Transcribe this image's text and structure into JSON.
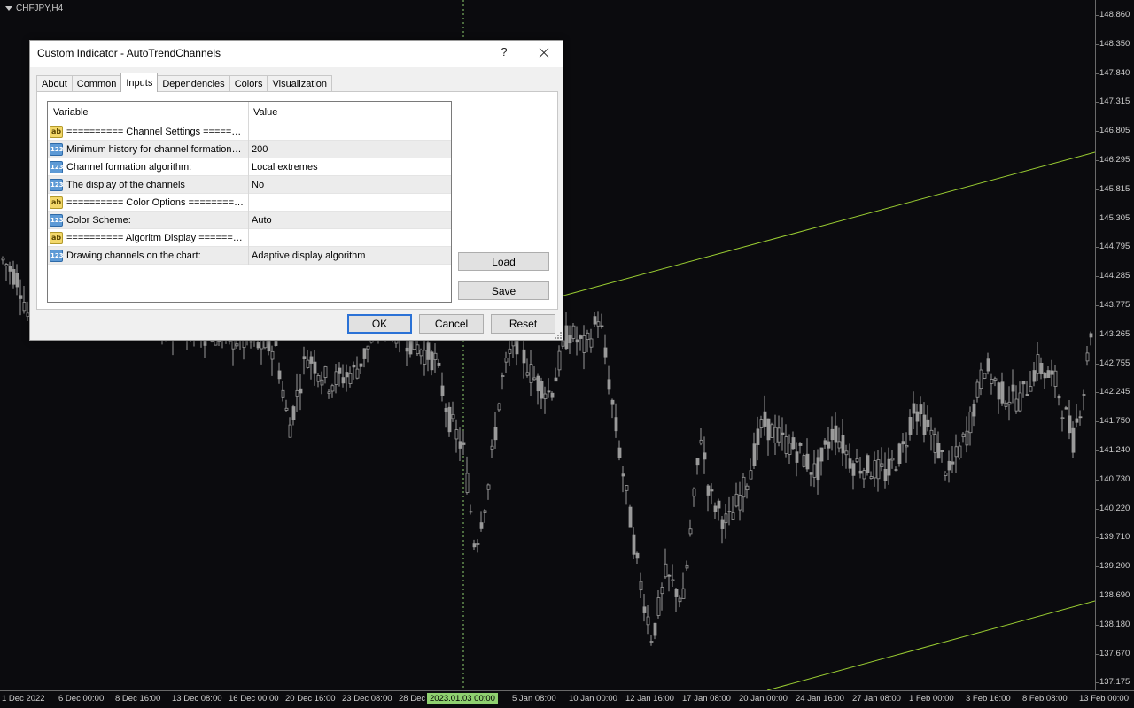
{
  "chart": {
    "symbol": "CHFJPY,H4",
    "price_ticks": [
      "148.860",
      "148.350",
      "147.840",
      "147.315",
      "146.805",
      "146.295",
      "145.815",
      "145.305",
      "144.795",
      "144.285",
      "143.775",
      "143.265",
      "142.755",
      "142.245",
      "141.750",
      "141.240",
      "140.730",
      "140.220",
      "139.710",
      "139.200",
      "138.690",
      "138.180",
      "137.670",
      "137.175"
    ],
    "time_ticks": [
      "1 Dec 2022",
      "6 Dec 00:00",
      "8 Dec 16:00",
      "13 Dec 08:00",
      "16 Dec 00:00",
      "20 Dec 16:00",
      "23 Dec 08:00",
      "28 Dec",
      "5 Jan 08:00",
      "10 Jan 00:00",
      "12 Jan 16:00",
      "17 Jan 08:00",
      "20 Jan 00:00",
      "24 Jan 16:00",
      "27 Jan 08:00",
      "1 Feb 00:00",
      "3 Feb 16:00",
      "8 Feb 08:00",
      "13 Feb 00:00"
    ],
    "cursor_time": "2023.01.03 00:00",
    "colors": {
      "background": "#0b0b0e",
      "candles": "#9a9a9a",
      "channel_lines": "#9acd32",
      "crosshair": "#8fd070"
    }
  },
  "dialog": {
    "title": "Custom Indicator - AutoTrendChannels",
    "help_label": "?",
    "tabs": [
      {
        "label": "About"
      },
      {
        "label": "Common"
      },
      {
        "label": "Inputs"
      },
      {
        "label": "Dependencies"
      },
      {
        "label": "Colors"
      },
      {
        "label": "Visualization"
      }
    ],
    "active_tab": "Inputs",
    "grid": {
      "header_variable": "Variable",
      "header_value": "Value",
      "rows": [
        {
          "icon": "ab",
          "variable": "========== Channel Settings ==========",
          "value": ""
        },
        {
          "icon": "123",
          "variable": "Minimum history for channel formation (bars)",
          "value": "200"
        },
        {
          "icon": "123",
          "variable": "Channel formation algorithm:",
          "value": "Local extremes"
        },
        {
          "icon": "123",
          "variable": "The display of the channels",
          "value": "No"
        },
        {
          "icon": "ab",
          "variable": "========== Color Options ==========",
          "value": ""
        },
        {
          "icon": "123",
          "variable": "Color Scheme:",
          "value": "Auto"
        },
        {
          "icon": "ab",
          "variable": "========== Algoritm Display ==========",
          "value": ""
        },
        {
          "icon": "123",
          "variable": "Drawing channels on the chart:",
          "value": "Adaptive display algorithm"
        }
      ]
    },
    "load_label": "Load",
    "save_label": "Save",
    "ok_label": "OK",
    "cancel_label": "Cancel",
    "reset_label": "Reset"
  }
}
